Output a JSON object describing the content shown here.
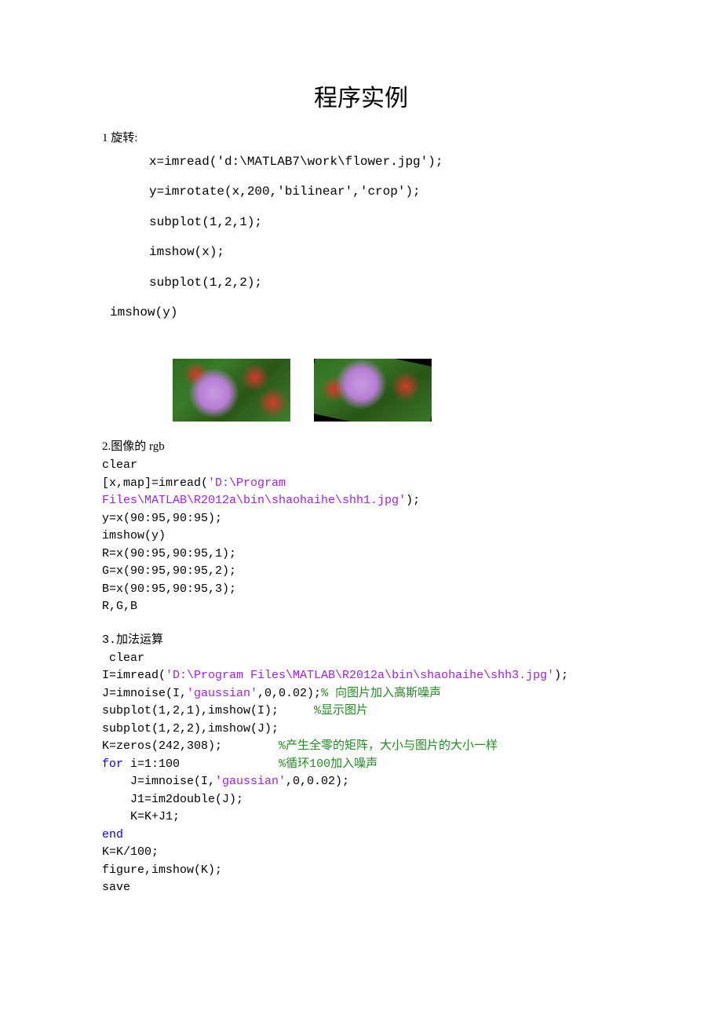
{
  "title": "程序实例",
  "section1": {
    "label": "1 旋转:",
    "code": [
      "x=imread('d:\\MATLAB7\\work\\flower.jpg');",
      "y=imrotate(x,200,'bilinear','crop');",
      "subplot(1,2,1);",
      "imshow(x);",
      "subplot(1,2,2);"
    ],
    "last": "imshow(y)"
  },
  "section2": {
    "label": "2.图像的 rgb",
    "l0": "clear",
    "l1a": "[x,map]=imread(",
    "l1b": "'D:\\Program",
    "l2a": "Files\\MATLAB\\R2012a\\bin\\shaohaihe\\shh1.jpg'",
    "l2b": ");",
    "l3": "y=x(90:95,90:95);",
    "l4": "imshow(y)",
    "l5": "R=x(90:95,90:95,1);",
    "l6": "G=x(90:95,90:95,2);",
    "l7": "B=x(90:95,90:95,3);",
    "l8": "R,G,B"
  },
  "section3": {
    "label": "3.加法运算",
    "l0": " clear",
    "l1a": "I=imread(",
    "l1b": "'D:\\Program Files\\MATLAB\\R2012a\\bin\\shaohaihe\\shh3.jpg'",
    "l1c": ");",
    "l2a": "J=imnoise(I,",
    "l2b": "'gaussian'",
    "l2c": ",0,0.02);",
    "l2d": "% 向图片加入高斯噪声",
    "l3a": "subplot(1,2,1),imshow(I);     ",
    "l3b": "%显示图片",
    "l4": "subplot(1,2,2),imshow(J);",
    "l5a": "K=zeros(242,308);        ",
    "l5b": "%产生全零的矩阵，大小与图片的大小一样",
    "l6a": "for",
    "l6b": " i=1:100              ",
    "l6c": "%循环100加入噪声",
    "l7a": "J=imnoise(I,",
    "l7b": "'gaussian'",
    "l7c": ",0,0.02);",
    "l8": "J1=im2double(J);",
    "l9": "K=K+J1;",
    "l10": "end",
    "l11": "K=K/100;",
    "l12": "figure,imshow(K);",
    "l13": "save"
  }
}
